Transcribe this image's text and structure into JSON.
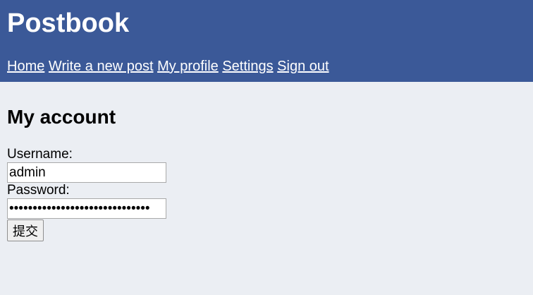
{
  "header": {
    "site_title": "Postbook",
    "nav": [
      {
        "label": "Home"
      },
      {
        "label": "Write a new post"
      },
      {
        "label": "My profile"
      },
      {
        "label": "Settings"
      },
      {
        "label": "Sign out"
      }
    ]
  },
  "main": {
    "page_title": "My account",
    "form": {
      "username_label": "Username:",
      "username_value": "admin",
      "password_label": "Password:",
      "password_value": "••••••••••••••••••••••••••••••",
      "submit_label": "提交"
    }
  },
  "colors": {
    "header_bg": "#3b5998",
    "page_bg": "#ebeef3",
    "header_text": "#ffffff"
  }
}
